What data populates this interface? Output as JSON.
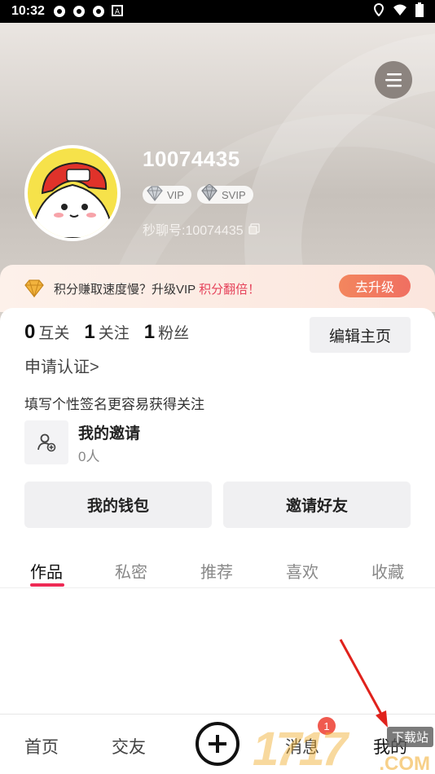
{
  "status_bar": {
    "time": "10:32"
  },
  "profile": {
    "user_id": "10074435",
    "badges": {
      "vip": "VIP",
      "svip": "SVIP"
    },
    "chat_id": "秒聊号:10074435"
  },
  "banner": {
    "text_main": "积分赚取速度慢？升级VIP",
    "text_highlight": "积分翻倍！",
    "button": "去升级"
  },
  "stats": [
    {
      "num": "0",
      "label": "互关"
    },
    {
      "num": "1",
      "label": "关注"
    },
    {
      "num": "1",
      "label": "粉丝"
    }
  ],
  "edit_button": "编辑主页",
  "verify_link": "申请认证>",
  "signature_hint": "填写个性签名更容易获得关注",
  "invite": {
    "title": "我的邀请",
    "count": "0人"
  },
  "actions": {
    "wallet": "我的钱包",
    "invite_friends": "邀请好友"
  },
  "tabs": [
    "作品",
    "私密",
    "推荐",
    "喜欢",
    "收藏"
  ],
  "bottom_nav": {
    "home": "首页",
    "friends": "交友",
    "messages": "消息",
    "messages_badge": "1",
    "mine": "我的"
  },
  "watermark": {
    "big": "1717",
    "tag": "下载站",
    "domain": ".COM"
  },
  "colors": {
    "accent": "#ee2a55",
    "upgrade": "#f07a5f",
    "highlight": "#e5425a"
  }
}
